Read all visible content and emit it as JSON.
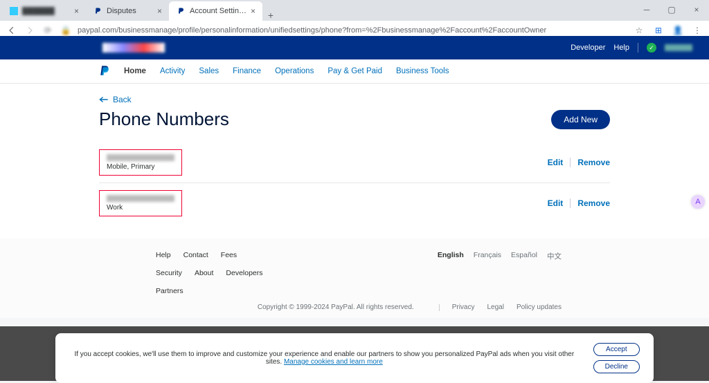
{
  "browser": {
    "tabs": [
      {
        "title": "██████",
        "active": false
      },
      {
        "title": "Disputes",
        "active": false
      },
      {
        "title": "Account Settings - PayPal",
        "active": true
      }
    ],
    "url": "paypal.com/businessmanage/profile/personalinformation/unifiedsettings/phone?from=%2Fbusinessmanage%2Faccount%2FaccountOwner"
  },
  "topbar": {
    "developer": "Developer",
    "help": "Help"
  },
  "nav": {
    "home": "Home",
    "activity": "Activity",
    "sales": "Sales",
    "finance": "Finance",
    "operations": "Operations",
    "pay": "Pay & Get Paid",
    "tools": "Business Tools"
  },
  "page": {
    "back": "Back",
    "title": "Phone Numbers",
    "add": "Add New",
    "edit": "Edit",
    "remove": "Remove",
    "phones": [
      {
        "label": "Mobile, Primary"
      },
      {
        "label": "Work"
      }
    ]
  },
  "footer": {
    "links": [
      "Help",
      "Contact",
      "Fees",
      "Security",
      "About",
      "Developers",
      "Partners"
    ],
    "langs": {
      "en": "English",
      "fr": "Français",
      "es": "Español",
      "zh": "中文"
    },
    "copyright": "Copyright © 1999-2024 PayPal. All rights reserved.",
    "legal": [
      "Privacy",
      "Legal",
      "Policy updates"
    ]
  },
  "cookies": {
    "text": "If you accept cookies, we'll use them to improve and customize your experience and enable our partners to show you personalized PayPal ads when you visit other sites. ",
    "manage": "Manage cookies and learn more",
    "accept": "Accept",
    "decline": "Decline"
  }
}
